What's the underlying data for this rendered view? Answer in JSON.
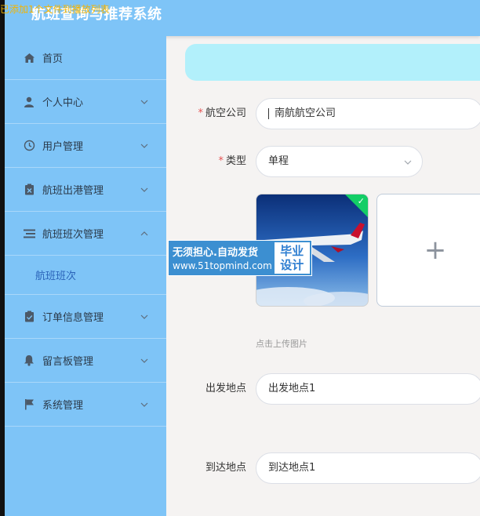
{
  "overlay": {
    "text": "已添加1个文件到播放列表"
  },
  "app": {
    "title": "航班查询与推荐系统"
  },
  "sidebar": {
    "items": [
      {
        "label": "首页",
        "icon": "home-icon"
      },
      {
        "label": "个人中心",
        "icon": "user-icon"
      },
      {
        "label": "用户管理",
        "icon": "clock-icon"
      },
      {
        "label": "航班出港管理",
        "icon": "clipboard-x-icon"
      },
      {
        "label": "航班班次管理",
        "icon": "list-icon"
      },
      {
        "label": "航班班次",
        "icon": ""
      },
      {
        "label": "订单信息管理",
        "icon": "clipboard-check-icon"
      },
      {
        "label": "留言板管理",
        "icon": "bell-icon"
      },
      {
        "label": "系统管理",
        "icon": "flag-icon"
      }
    ]
  },
  "form": {
    "airline": {
      "label": "航空公司",
      "value": "南航航空公司"
    },
    "type": {
      "label": "类型",
      "value": "单程"
    },
    "image": {
      "hint": "点击上传图片",
      "add_symbol": "+"
    },
    "departure": {
      "label": "出发地点",
      "value": "出发地点1"
    },
    "arrival": {
      "label": "到达地点",
      "value": "到达地点1"
    }
  },
  "watermark": {
    "line1": "无须担心.自动发货",
    "line2": "www.51topmind.com",
    "badge1": "毕业",
    "badge2": "设计"
  },
  "colors": {
    "sidebar": "#7ec4f7",
    "banner": "#b2f0fb",
    "required": "#e55353",
    "success": "#13ce66"
  }
}
